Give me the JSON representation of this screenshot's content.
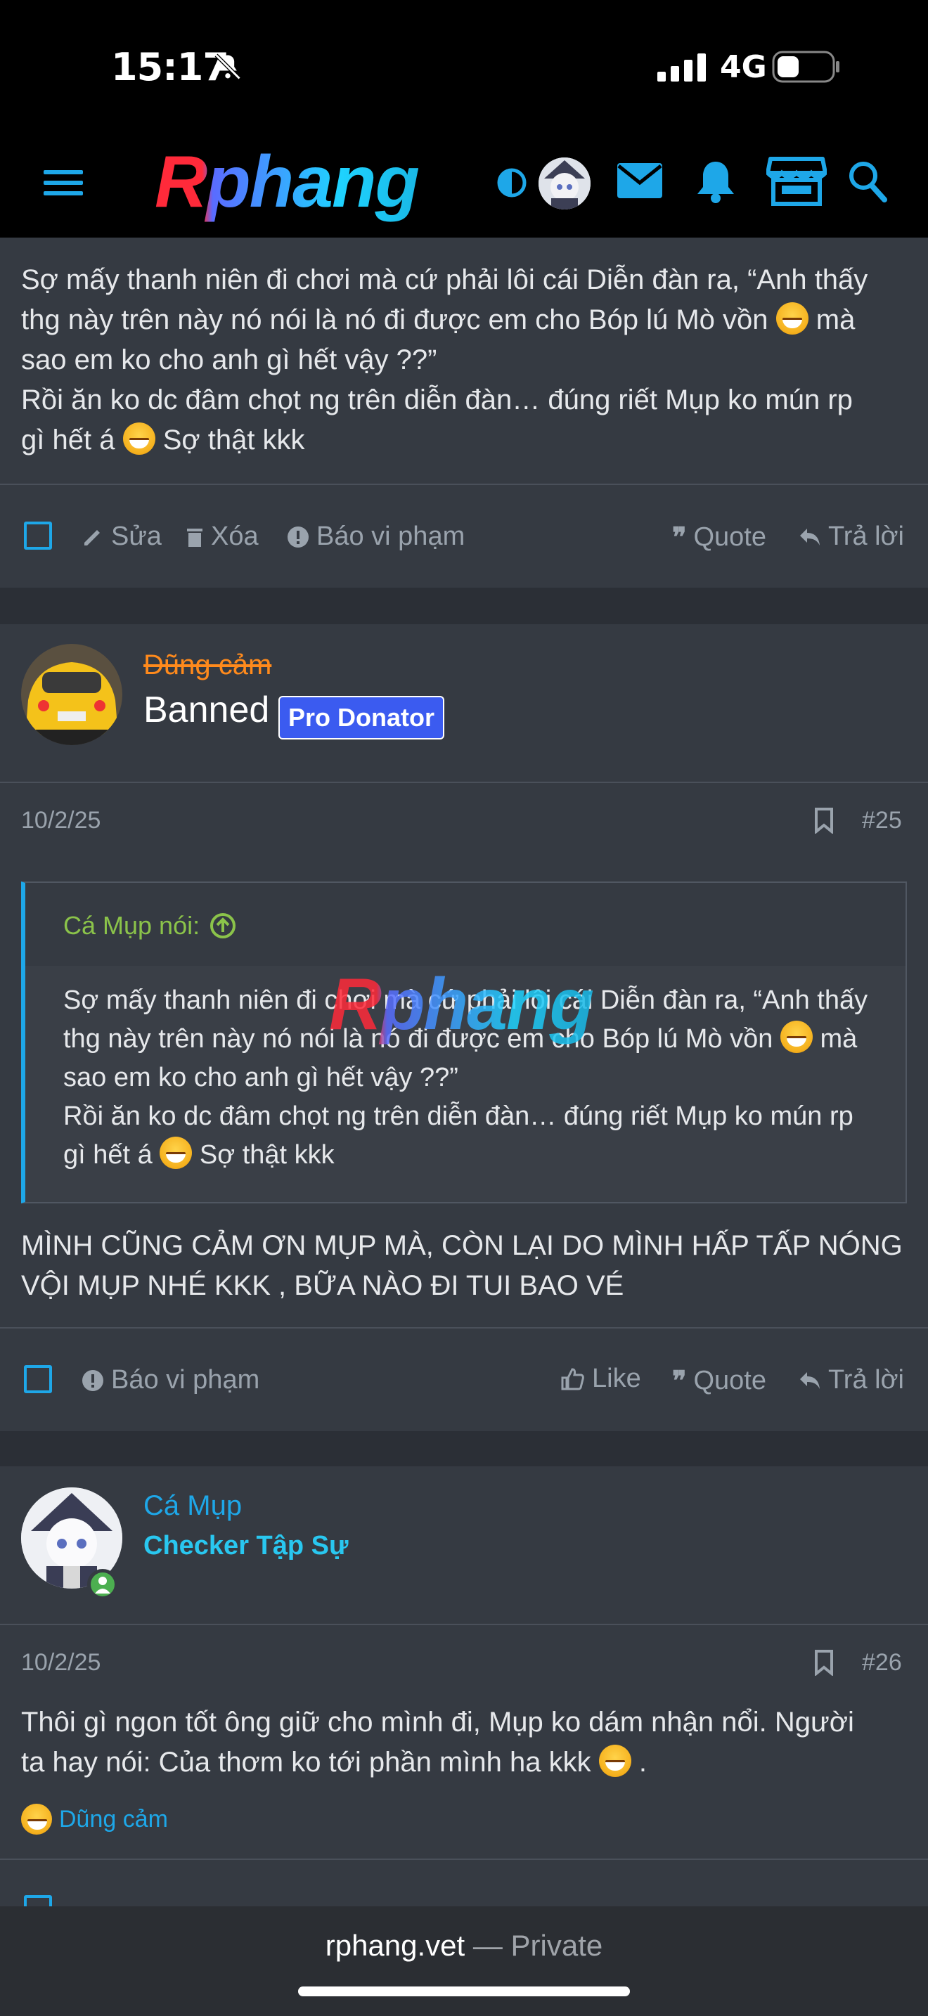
{
  "status_bar": {
    "time": "15:17",
    "network": "4G"
  },
  "nav": {
    "logo": "Rphang"
  },
  "post24": {
    "text_lines": [
      "Sợ mấy thanh niên đi chơi mà cứ phải lôi cái Diễn đàn ra, “Anh thấy",
      "thg này trên này nó nói là nó đi được em cho Bóp lú Mò vồn",
      "mà",
      "sao em ko cho anh gì hết vậy ??”",
      "Rồi ăn ko dc đâm chọt ng trên diễn đàn… đúng riết Mụp ko mún rp",
      "gì hết á",
      "Sợ thật kkk"
    ],
    "actions": {
      "edit": "Sửa",
      "delete": "Xóa",
      "report": "Báo vi phạm",
      "quote": "Quote",
      "reply": "Trả lời"
    }
  },
  "post25": {
    "username": "Dũng cảm",
    "title": "Banned",
    "badge": "Pro Donator",
    "date": "10/2/25",
    "number": "#25",
    "quote": {
      "author": "Cá Mụp nói:",
      "lines": [
        "Sợ mấy thanh niên đi chơi mà cứ phải lôi cái Diễn đàn ra, “Anh thấy",
        "thg này trên này nó nói là nó đi được em cho Bóp lú Mò vồn",
        "mà",
        "sao em ko cho anh gì hết vậy ??”",
        "Rồi ăn ko dc đâm chọt ng trên diễn đàn… đúng riết Mụp ko mún rp",
        "gì hết á",
        "Sợ thật kkk"
      ]
    },
    "body_lines": [
      "MÌNH CŨNG CẢM ƠN MỤP MÀ, CÒN LẠI DO MÌNH HẤP TẤP NÓNG",
      "VỘI MỤP NHÉ KKK , BỮA NÀO ĐI TUI BAO VÉ"
    ],
    "actions": {
      "report": "Báo vi phạm",
      "like": "Like",
      "quote": "Quote",
      "reply": "Trả lời"
    }
  },
  "post26": {
    "username": "Cá Mụp",
    "title": "Checker Tập Sự",
    "date": "10/2/25",
    "number": "#26",
    "body_lines": [
      "Thôi gì ngon tốt ông giữ cho mình đi, Mụp ko dám nhận nổi. Người",
      "ta hay nói: Của thơm ko tới phần mình ha kkk",
      "."
    ],
    "reaction_user": "Dũng cảm"
  },
  "browser": {
    "domain": "rphang.vet",
    "separator": "—",
    "mode": "Private"
  },
  "colors": {
    "accent": "#1ea7e8",
    "bg": "#2b2f36",
    "card": "#353a42",
    "quote_author": "#8bc34a",
    "badge": "#3b5bf0"
  }
}
